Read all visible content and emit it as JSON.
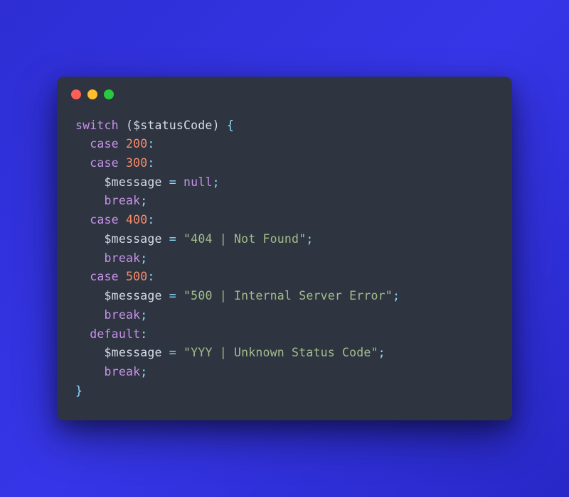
{
  "window": {
    "dots": [
      "red",
      "yellow",
      "green"
    ]
  },
  "code": {
    "kw_switch": "switch",
    "paren_open": "(",
    "var_status": "$statusCode",
    "paren_close": ")",
    "brace_open": "{",
    "kw_case": "case",
    "num_200": "200",
    "num_300": "300",
    "num_400": "400",
    "num_500": "500",
    "colon": ":",
    "var_message": "$message",
    "eq": "=",
    "null": "null",
    "semi": ";",
    "kw_break": "break",
    "str_404": "\"404 | Not Found\"",
    "str_500": "\"500 | Internal Server Error\"",
    "kw_default": "default",
    "str_yyy": "\"YYY | Unknown Status Code\"",
    "brace_close": "}"
  }
}
